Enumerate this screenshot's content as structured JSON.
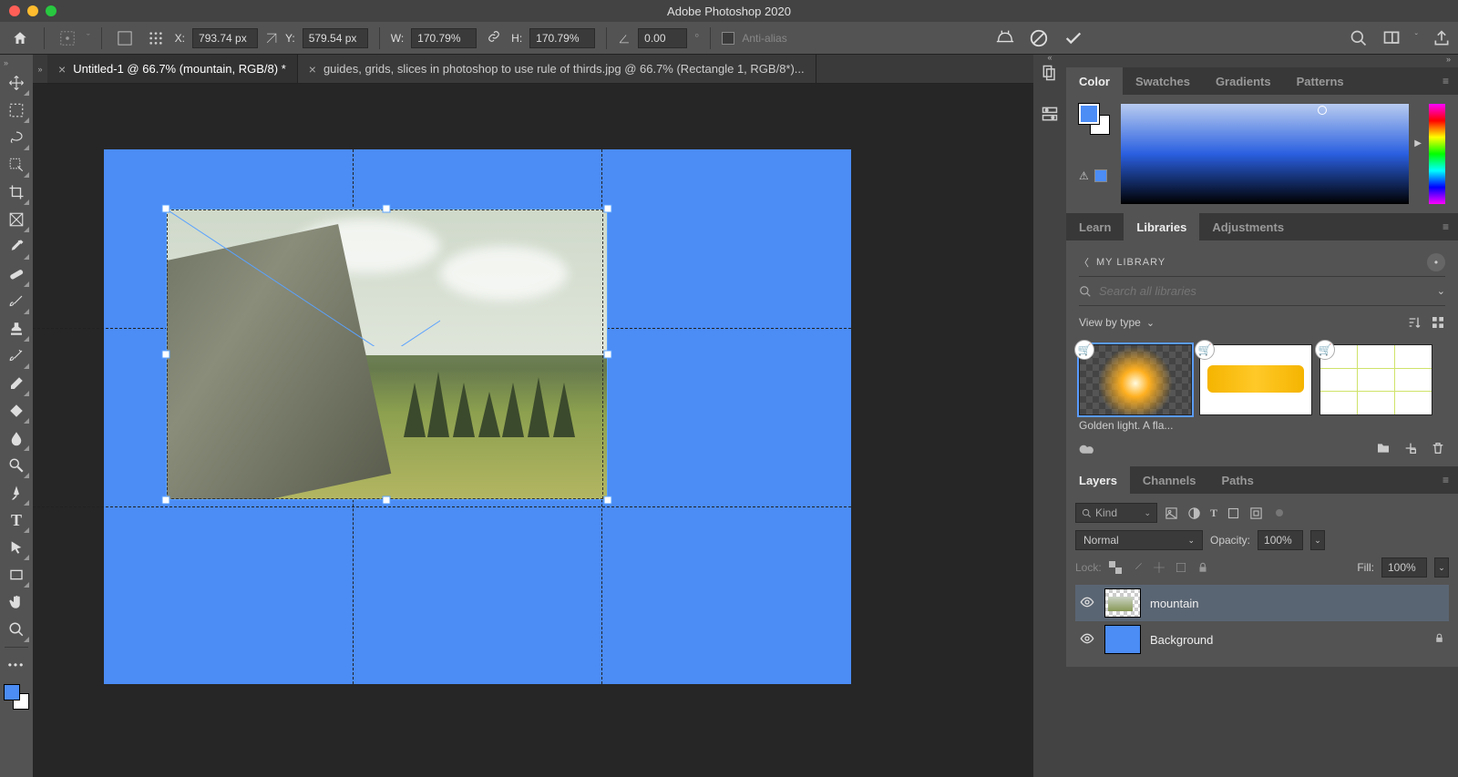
{
  "app": {
    "title": "Adobe Photoshop 2020"
  },
  "options_bar": {
    "x_label": "X:",
    "x_value": "793.74 px",
    "y_label": "Y:",
    "y_value": "579.54 px",
    "w_label": "W:",
    "w_value": "170.79%",
    "h_label": "H:",
    "h_value": "170.79%",
    "angle_label": "",
    "angle_value": "0.00",
    "antialias_label": "Anti-alias"
  },
  "tabs": [
    {
      "label": "Untitled-1 @ 66.7% (mountain, RGB/8) *",
      "active": true
    },
    {
      "label": "guides, grids, slices in photoshop to use rule of thirds.jpg @ 66.7% (Rectangle 1, RGB/8*)...",
      "active": false
    }
  ],
  "panels": {
    "color_tabs": [
      "Color",
      "Swatches",
      "Gradients",
      "Patterns"
    ],
    "lib_tabs": [
      "Learn",
      "Libraries",
      "Adjustments"
    ],
    "lib": {
      "breadcrumb": "MY LIBRARY",
      "search_placeholder": "Search all libraries",
      "view_label": "View by type",
      "items": [
        {
          "caption": "Golden light. A fla..."
        },
        {
          "caption": ""
        },
        {
          "caption": ""
        }
      ]
    },
    "layers_tabs": [
      "Layers",
      "Channels",
      "Paths"
    ],
    "layers": {
      "kind_label": "Kind",
      "blend_mode": "Normal",
      "opacity_label": "Opacity:",
      "opacity_value": "100%",
      "lock_label": "Lock:",
      "fill_label": "Fill:",
      "fill_value": "100%",
      "items": [
        {
          "name": "mountain",
          "selected": true,
          "thumb": "checker"
        },
        {
          "name": "Background",
          "selected": false,
          "thumb": "blue",
          "locked": true
        }
      ]
    }
  }
}
